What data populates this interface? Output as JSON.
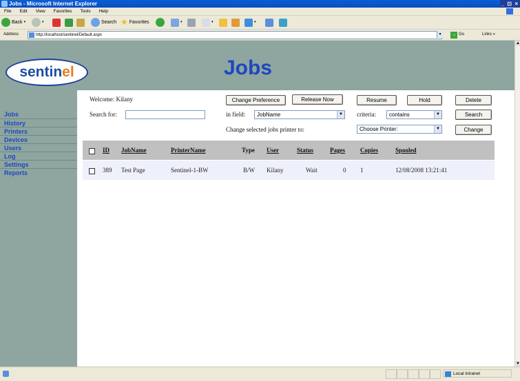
{
  "browser": {
    "title": "Jobs - Microsoft Internet Explorer",
    "window_buttons": "_ ⊡ ×",
    "menu": [
      "File",
      "Edit",
      "View",
      "Favorites",
      "Tools",
      "Help"
    ],
    "toolbar": {
      "back": "Back",
      "search": "Search",
      "favorites": "Favorites"
    },
    "address_label": "Address",
    "address_url": "http://localhost/sentinel/Default.aspx",
    "go_label": "Go",
    "links_label": "Links",
    "status_zone": "Local intranet"
  },
  "app": {
    "logo_text_a": "sentin",
    "logo_text_b": "el",
    "page_title": "Jobs",
    "nav": [
      "Jobs",
      "History",
      "Printers",
      "Devices",
      "Users",
      "Log",
      "Settings",
      "Reports"
    ],
    "welcome": "Welcome: Kilany",
    "buttons": {
      "change_preference": "Change Preference",
      "release_now": "Release Now",
      "resume": "Resume",
      "hold": "Hold",
      "delete": "Delete",
      "search": "Search",
      "change": "Change"
    },
    "search_label": "Search for:",
    "search_value": "",
    "field_label": "in field:",
    "field_value": "JobName",
    "criteria_label": "criteria:",
    "criteria_value": "contains",
    "printer_label": "Change selected jobs printer to:",
    "printer_value": "Choose Printer:"
  },
  "table": {
    "headers": [
      "ID",
      "JobName",
      "PrinterName",
      "Type",
      "User",
      "Status",
      "Pages",
      "Copies",
      "Spooled"
    ],
    "rows": [
      [
        "389",
        "Test Page",
        "Sentinel-1-BW",
        "B/W",
        "Kilany",
        "Wait",
        "0",
        "1",
        "12/08/2008 13:21:41"
      ]
    ]
  }
}
